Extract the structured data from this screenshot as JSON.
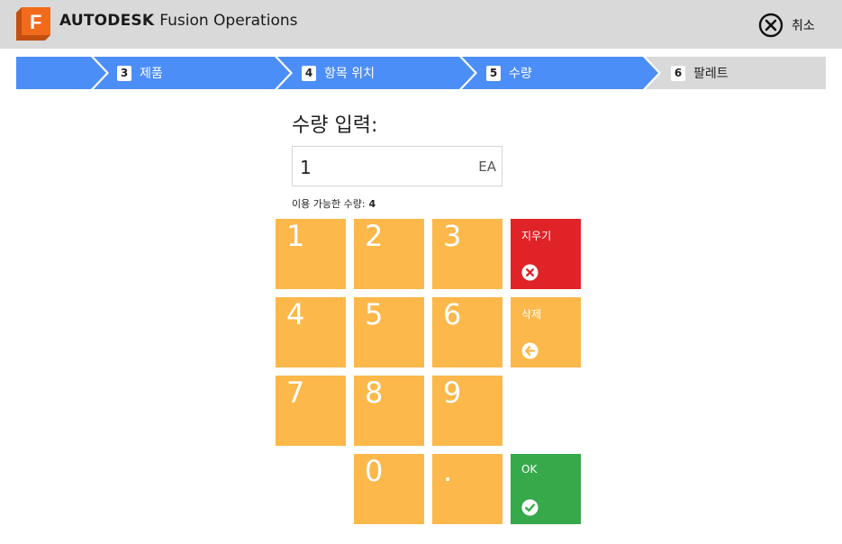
{
  "header": {
    "brand_bold": "AUTODESK",
    "brand_rest": "Fusion Operations",
    "logo_letter": "F",
    "logo_icon": "fusion-logo-icon",
    "cancel_icon": "close-circle-icon",
    "cancel_label": "취소"
  },
  "steps": [
    {
      "num": "3",
      "label": "제품",
      "state": "complete"
    },
    {
      "num": "4",
      "label": "항목 위치",
      "state": "complete"
    },
    {
      "num": "5",
      "label": "수량",
      "state": "active"
    },
    {
      "num": "6",
      "label": "팔레트",
      "state": "upcoming"
    }
  ],
  "quantity": {
    "title": "수량 입력:",
    "value": "1",
    "unit": "EA",
    "available_label": "이용 가능한 수량:",
    "available_value": "4"
  },
  "keypad": {
    "keys": [
      "1",
      "2",
      "3",
      "4",
      "5",
      "6",
      "7",
      "8",
      "9",
      "0",
      "."
    ],
    "clear": {
      "label": "지우기",
      "icon": "clear-x-circle-icon"
    },
    "delete": {
      "label": "삭제",
      "icon": "backspace-arrow-circle-icon"
    },
    "ok": {
      "label": "OK",
      "icon": "checkmark-circle-icon"
    }
  },
  "colors": {
    "header_bg": "#d9d9d9",
    "step_active": "#4c8ef7",
    "step_inactive": "#d9d9d9",
    "key_orange": "#fcb84a",
    "clear_red": "#e02326",
    "ok_green": "#36a94a",
    "logo_orange": "#f26a1b"
  }
}
